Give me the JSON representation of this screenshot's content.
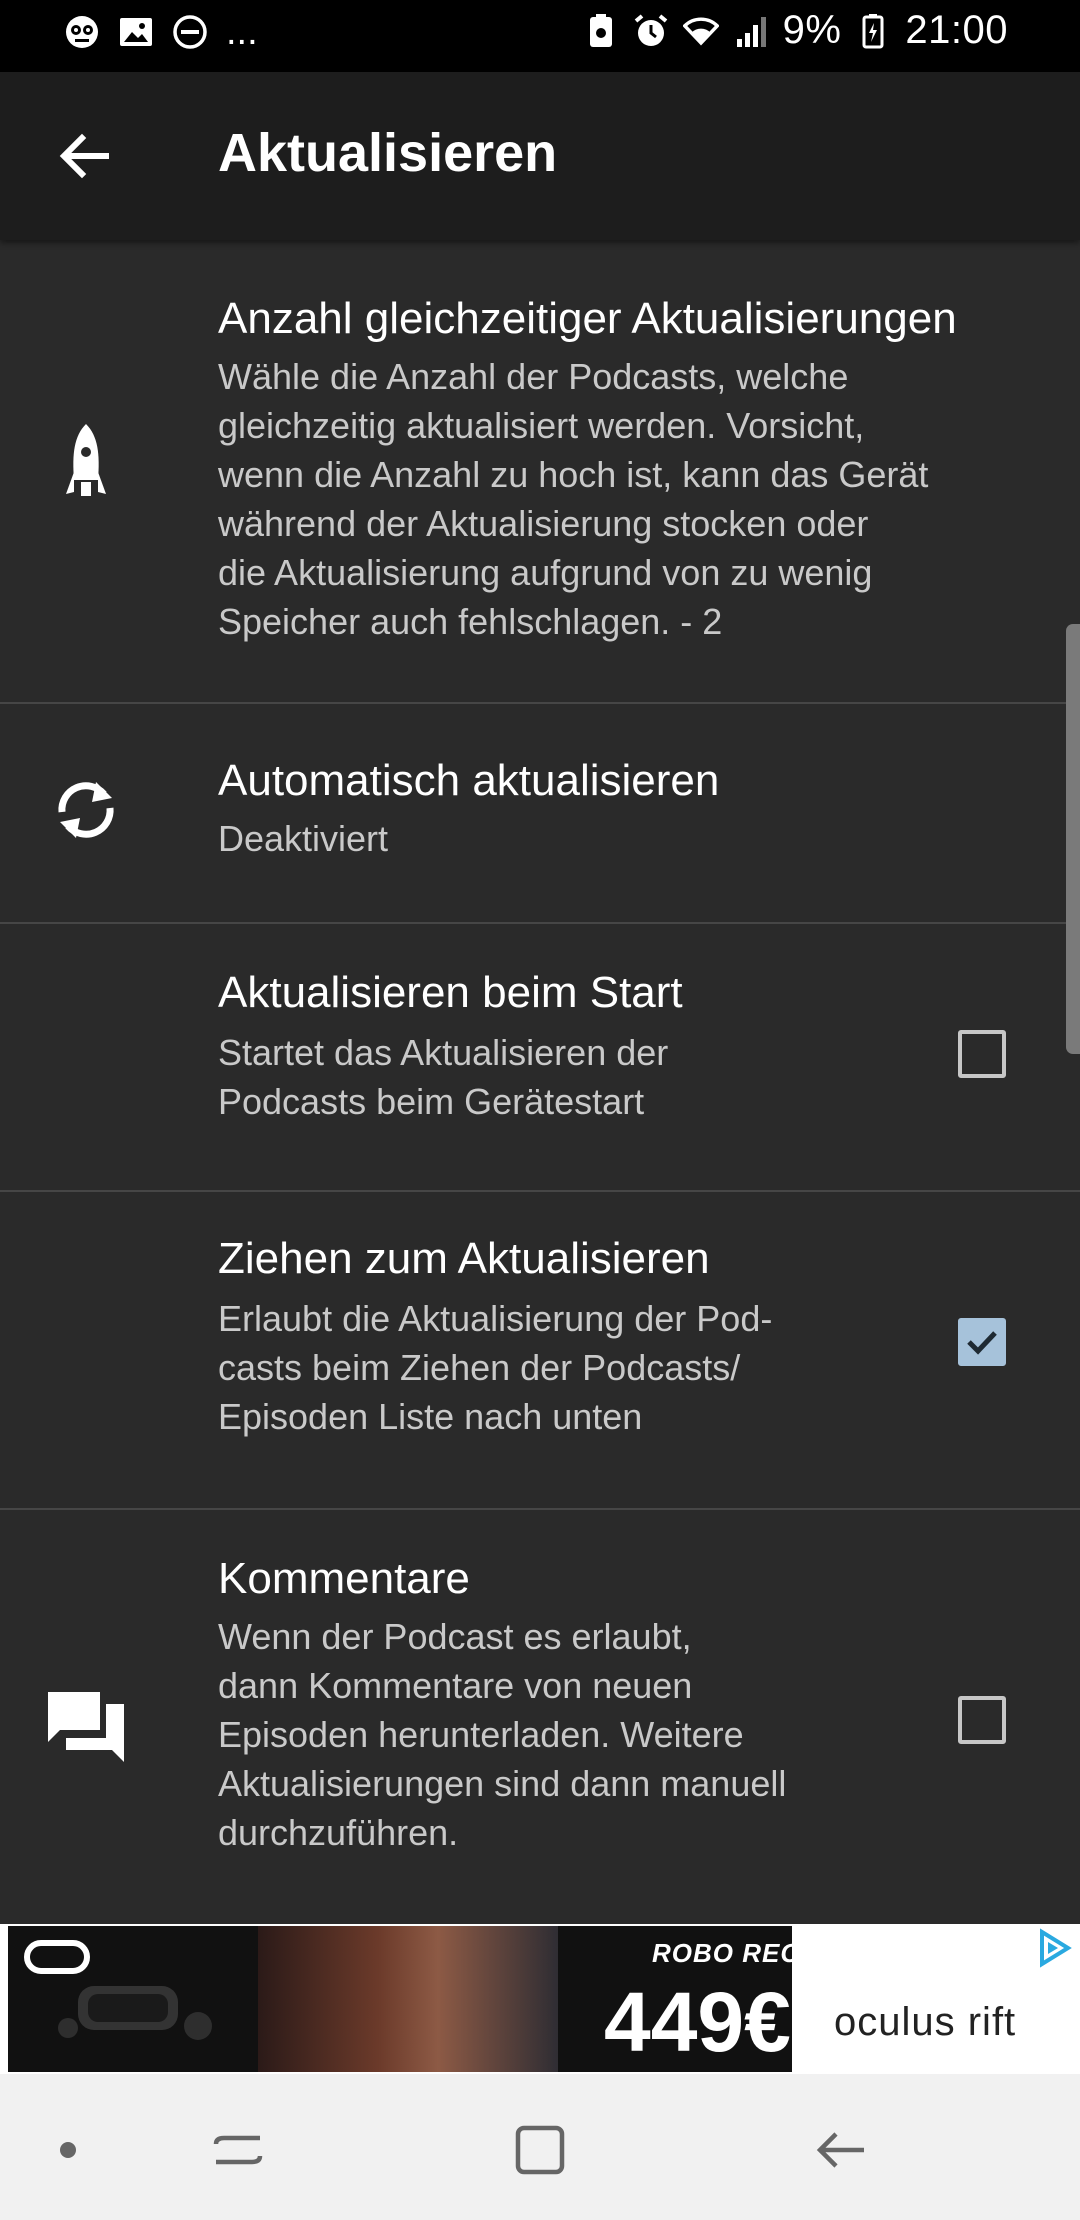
{
  "status_bar": {
    "battery": "9%",
    "time": "21:00",
    "more": "..."
  },
  "app_bar": {
    "title": "Aktualisieren"
  },
  "settings": [
    {
      "title": "Anzahl gleichzeitiger Aktualisierungen",
      "summary": "Wähle die Anzahl der Podcasts, welche\ngleichzeitig aktualisiert werden. Vorsicht,\nwenn die Anzahl zu hoch ist, kann das Gerät\nwährend der Aktualisierung stocken oder\ndie Aktualisierung aufgrund von zu wenig\nSpeicher auch fehlschlagen. - 2",
      "icon": "rocket-icon"
    },
    {
      "title": "Automatisch aktualisieren",
      "summary": "Deaktiviert",
      "icon": "sync-icon"
    },
    {
      "title": "Aktualisieren beim Start",
      "summary": "Startet das Aktualisieren der\nPodcasts beim Gerätestart",
      "checked": false
    },
    {
      "title": "Ziehen zum Aktualisieren",
      "summary": "Erlaubt die Aktualisierung der Pod-\ncasts beim Ziehen der Podcasts/\nEpisoden Liste nach unten",
      "checked": true
    },
    {
      "title": "Kommentare",
      "summary": "Wenn der Podcast es erlaubt,\ndann Kommentare von neuen\nEpisoden herunterladen. Weitere\nAktualisierungen sind dann manuell\ndurchzuführen.",
      "icon": "forum-icon",
      "checked": false
    }
  ],
  "ad": {
    "brand": "ROBO RECALL",
    "price": "449€",
    "logo": "oculus rift"
  },
  "colors": {
    "background": "#2a2a2a",
    "app_bar": "#1d1d1d",
    "checkbox_checked": "#a6c2da"
  }
}
